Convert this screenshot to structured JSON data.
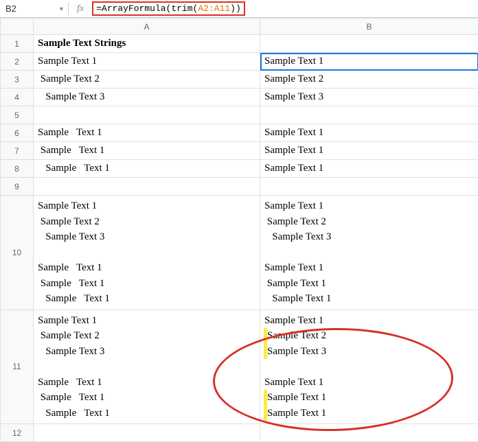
{
  "formula_bar": {
    "cell_ref": "B2",
    "fx_label": "fx",
    "formula_prefix": "=ArrayFormula(trim(",
    "formula_range": "A2:A11",
    "formula_suffix": "))"
  },
  "columns": [
    "A",
    "B"
  ],
  "rows": [
    {
      "num": "1",
      "a": "Sample Text Strings",
      "b": "",
      "bold": true
    },
    {
      "num": "2",
      "a": "Sample Text 1",
      "b": "Sample Text 1",
      "selected_b": true
    },
    {
      "num": "3",
      "a": " Sample Text 2",
      "b": "Sample Text 2"
    },
    {
      "num": "4",
      "a": "   Sample Text 3",
      "b": "Sample Text 3"
    },
    {
      "num": "5",
      "a": "",
      "b": ""
    },
    {
      "num": "6",
      "a": "Sample   Text 1",
      "b": "Sample Text 1"
    },
    {
      "num": "7",
      "a": " Sample   Text 1",
      "b": "Sample Text 1"
    },
    {
      "num": "8",
      "a": "   Sample   Text 1",
      "b": "Sample Text 1"
    },
    {
      "num": "9",
      "a": "",
      "b": ""
    },
    {
      "num": "10",
      "a_lines": [
        "Sample Text 1",
        " Sample Text 2",
        "   Sample Text 3",
        "",
        "Sample   Text 1",
        " Sample   Text 1",
        "   Sample   Text 1"
      ],
      "b_lines": [
        "Sample Text 1",
        " Sample Text 2",
        "   Sample Text 3",
        "",
        "Sample Text 1",
        " Sample Text 1",
        "   Sample Text 1"
      ],
      "multi": true
    },
    {
      "num": "11",
      "a_lines": [
        "Sample Text 1",
        " Sample Text 2",
        "   Sample Text 3",
        "",
        "Sample   Text 1",
        " Sample   Text 1",
        "   Sample   Text 1"
      ],
      "b_lines_marked": [
        {
          "t": "Sample Text 1",
          "y": false
        },
        {
          "t": "Sample Text 2",
          "y": true
        },
        {
          "t": "Sample Text 3",
          "y": true
        },
        {
          "t": "",
          "y": false
        },
        {
          "t": "Sample Text 1",
          "y": false
        },
        {
          "t": "Sample Text 1",
          "y": true
        },
        {
          "t": "Sample Text 1",
          "y": true
        }
      ],
      "multi": true
    },
    {
      "num": "12",
      "a": "",
      "b": ""
    }
  ]
}
